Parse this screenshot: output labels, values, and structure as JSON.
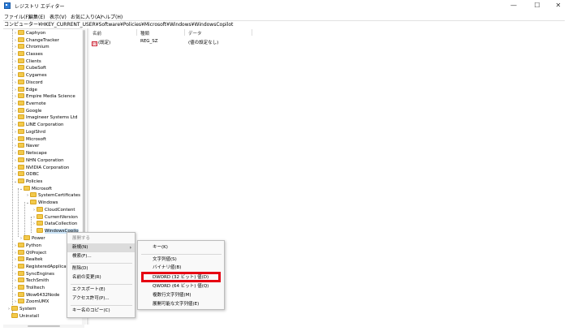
{
  "window": {
    "title": "レジストリ エディター",
    "controls": [
      "—",
      "☐",
      "✕"
    ]
  },
  "menu": [
    "ファイル(F)",
    "編集(E)",
    "表示(V)",
    "お気に入り(A)",
    "ヘルプ(H)"
  ],
  "address": "コンピューター¥HKEY_CURRENT_USER¥Software¥Policies¥Microsoft¥Windows¥WindowsCopilot",
  "tree": [
    {
      "label": "Caphyon",
      "exp": "›"
    },
    {
      "label": "ChangeTracker",
      "exp": "›"
    },
    {
      "label": "Chromium",
      "exp": "›"
    },
    {
      "label": "Classes",
      "exp": "›"
    },
    {
      "label": "Clients",
      "exp": "›"
    },
    {
      "label": "CubeSoft",
      "exp": "›"
    },
    {
      "label": "Cygames",
      "exp": "›"
    },
    {
      "label": "Discord",
      "exp": "›"
    },
    {
      "label": "Edge",
      "exp": "›"
    },
    {
      "label": "Empire Media Science",
      "exp": "›"
    },
    {
      "label": "Evernote",
      "exp": "›"
    },
    {
      "label": "Google",
      "exp": "›"
    },
    {
      "label": "Imagineer Systems Ltd",
      "exp": "›"
    },
    {
      "label": "LINE Corporation",
      "exp": "›"
    },
    {
      "label": "LogiShrd",
      "exp": "›"
    },
    {
      "label": "Microsoft",
      "exp": "›"
    },
    {
      "label": "Naver",
      "exp": "›"
    },
    {
      "label": "Netscape",
      "exp": "›"
    },
    {
      "label": "NHN Corporation",
      "exp": "›"
    },
    {
      "label": "NVIDIA Corporation",
      "exp": "›"
    },
    {
      "label": "ODBC",
      "exp": "›"
    },
    {
      "label": "Policies",
      "exp": "⌄"
    },
    {
      "label": "Microsoft",
      "exp": "⌄"
    },
    {
      "label": "SystemCertificates",
      "exp": "›"
    },
    {
      "label": "Windows",
      "exp": "⌄"
    },
    {
      "label": "CloudContent",
      "exp": "›"
    },
    {
      "label": "CurrentVersion",
      "exp": "›"
    },
    {
      "label": "DataCollection",
      "exp": "›"
    },
    {
      "label": "WindowsCopilo",
      "exp": ""
    },
    {
      "label": "Power",
      "exp": "›"
    },
    {
      "label": "Python",
      "exp": "›"
    },
    {
      "label": "QtProject",
      "exp": "›"
    },
    {
      "label": "Realtek",
      "exp": "›"
    },
    {
      "label": "RegisteredApplicat",
      "exp": "›"
    },
    {
      "label": "SyncEngines",
      "exp": "›"
    },
    {
      "label": "TechSmith",
      "exp": "›"
    },
    {
      "label": "Trolltech",
      "exp": "›"
    },
    {
      "label": "Wow6432Node",
      "exp": "›"
    },
    {
      "label": "ZoomUMX",
      "exp": "›"
    },
    {
      "label": "System",
      "exp": "›"
    },
    {
      "label": "Uninstall",
      "exp": ""
    }
  ],
  "list": {
    "columns": [
      "名前",
      "種類",
      "データ"
    ],
    "rows": [
      {
        "name": "(既定)",
        "type": "REG_SZ",
        "data": "(値の設定なし)",
        "icon": "ab"
      }
    ]
  },
  "context_menu": {
    "items": [
      "展開する",
      "新規(N)",
      "検索(F)...",
      "削除(D)",
      "名前の変更(R)",
      "エクスポート(E)",
      "アクセス許可(P)...",
      "キー名のコピー(C)"
    ]
  },
  "submenu": {
    "items": [
      "キー(K)",
      "文字列値(S)",
      "バイナリ値(B)",
      "DWORD (32 ビット) 値(D)",
      "QWORD (64 ビット) 値(Q)",
      "複数行文字列値(M)",
      "展開可能な文字列値(E)"
    ]
  },
  "colors": {
    "selection": "#cce4f7",
    "highlight": "#e60012",
    "folder": "#f2c94c"
  }
}
